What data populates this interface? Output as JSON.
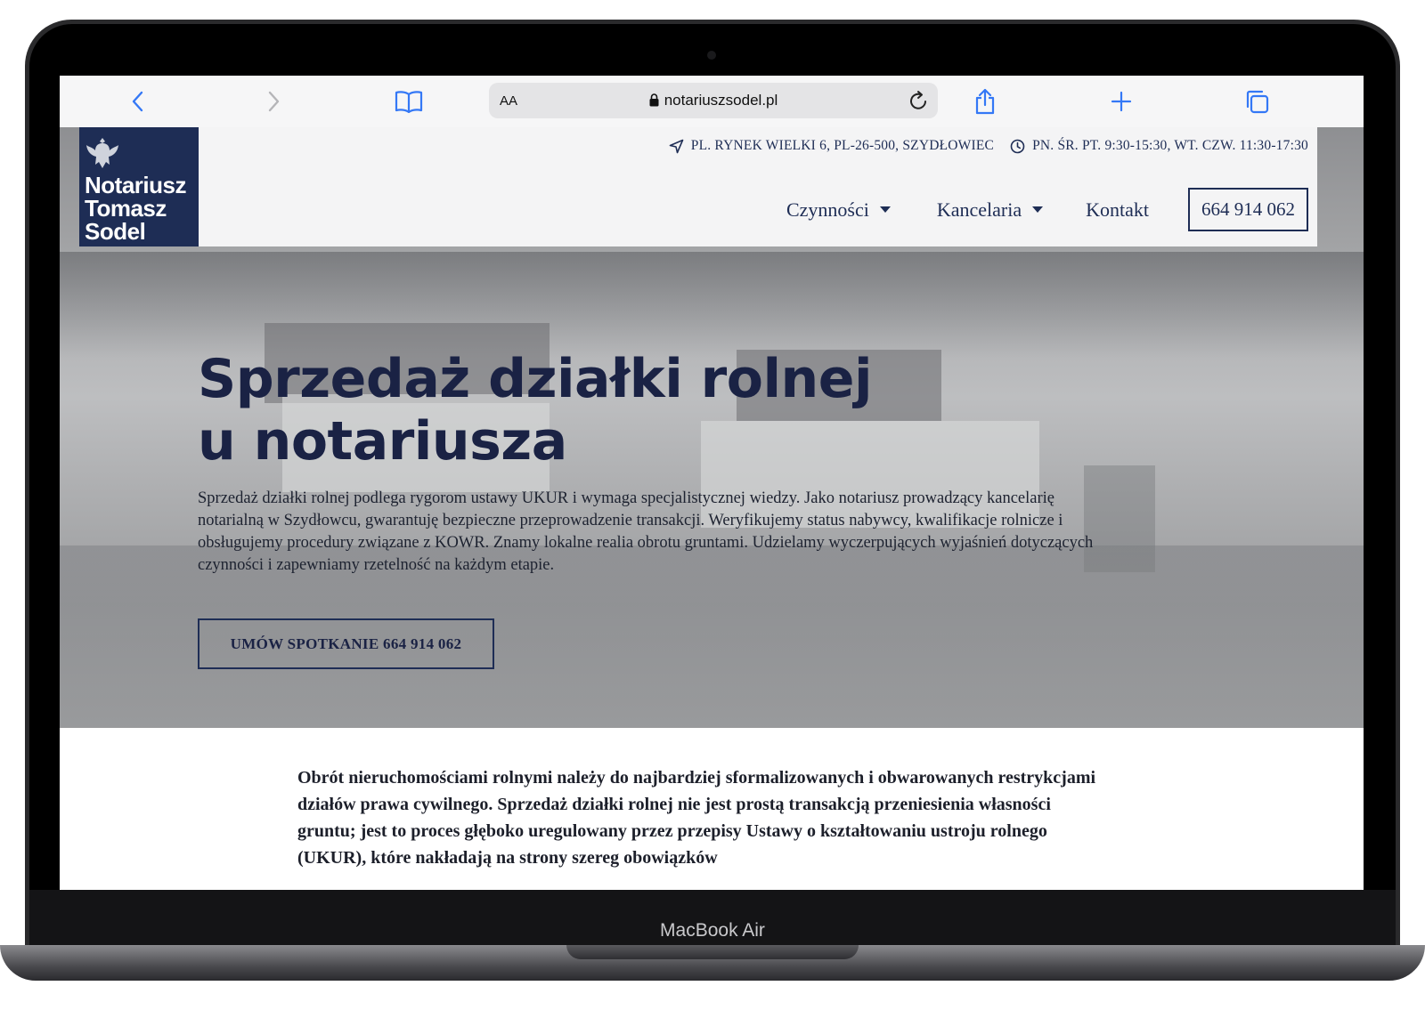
{
  "device": {
    "brand_label": "MacBook Air"
  },
  "browser": {
    "address_aa": "AA",
    "url": "notariuszsodel.pl"
  },
  "site": {
    "logo": {
      "line1": "Notariusz",
      "line2": "Tomasz",
      "line3": "Sodel"
    },
    "topbar": {
      "address": "PL. RYNEK WIELKI 6, PL-26-500, SZYDŁOWIEC",
      "hours": "PN. ŚR. PT. 9:30-15:30, WT. CZW. 11:30-17:30"
    },
    "nav": {
      "items": [
        {
          "label": "Czynności"
        },
        {
          "label": "Kancelaria"
        },
        {
          "label": "Kontakt"
        }
      ],
      "phone": "664 914 062"
    },
    "hero": {
      "title_line1": "Sprzedaż działki rolnej",
      "title_line2": "u notariusza",
      "text": "Sprzedaż działki rolnej podlega rygorom ustawy UKUR i wymaga specjalistycznej wiedzy. Jako notariusz prowadzący kancelarię notarialną w Szydłowcu, gwarantuję bezpieczne przeprowadzenie transakcji. Weryfikujemy status nabywcy, kwalifikacje rolnicze i obsługujemy procedury związane z KOWR. Znamy lokalne realia obrotu gruntami. Udzielamy wyczerpujących wyjaśnień dotyczących czynności i zapewniamy rzetelność na każdym etapie.",
      "cta": "UMÓW SPOTKANIE 664 914 062"
    },
    "content": {
      "intro": "Obrót nieruchomościami rolnymi należy do najbardziej sformalizowanych i obwarowanych restrykcjami działów prawa cywilnego. Sprzedaż działki rolnej nie jest prostą transakcją przeniesienia własności gruntu; jest to proces głęboko uregulowany przez przepisy Ustawy o kształtowaniu ustroju rolnego (UKUR), które nakładają na strony szereg obowiązków"
    }
  },
  "colors": {
    "brand_navy": "#1e2d55",
    "safari_blue": "#3478f6"
  }
}
